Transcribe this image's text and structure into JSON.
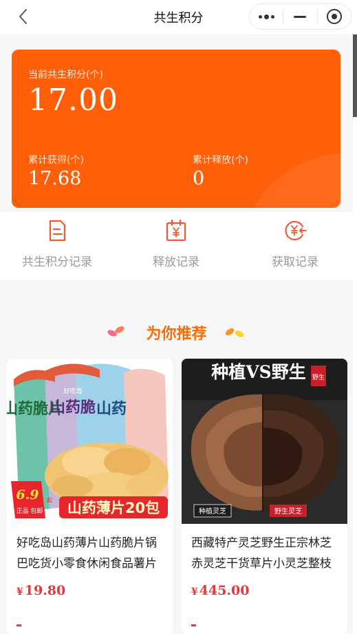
{
  "header": {
    "title": "共生积分",
    "back_icon": "chevron-left-icon",
    "capsule": {
      "more_icon": "more-dots-icon",
      "minimize_icon": "minus-icon",
      "close_icon": "target-icon"
    }
  },
  "points_card": {
    "current_label": "当前共生积分(个)",
    "current_value": "17.00",
    "earned_label": "累计获得(个)",
    "earned_value": "17.68",
    "released_label": "累计释放(个)",
    "released_value": "0",
    "background_color": "#ff5f08"
  },
  "shortcuts": [
    {
      "label": "共生积分记录",
      "icon": "document-icon"
    },
    {
      "label": "释放记录",
      "icon": "calendar-yen-icon"
    },
    {
      "label": "获取记录",
      "icon": "yen-coin-arrow-icon"
    }
  ],
  "recommend": {
    "title": "为你推荐",
    "accent_color": "#ff6a00"
  },
  "products": [
    {
      "name": "好吃岛山药薄片山药脆片锅巴吃货小零食休闲食品薯片",
      "currency": "¥",
      "price": "19.80",
      "image": {
        "bag_text": "山药脆片",
        "bag_text_2": "山药脆",
        "bag_text_3": "山药",
        "brand": "好吃岛",
        "badge_price": "6.9",
        "badge_unit": "起",
        "badge_sub": "正品 包邮",
        "banner": "山药薄片20包"
      }
    },
    {
      "name": "西藏特产灵芝野生正宗林芝赤灵芝干货草片小灵芝整枝",
      "currency": "¥",
      "price": "445.00",
      "image": {
        "headline": "种植VS野生",
        "corner_tag": "野生",
        "left_label": "种植灵芝",
        "right_label": "野生灵芝"
      }
    }
  ],
  "colors": {
    "price": "#e4393c",
    "page_bg": "#f6f6f6"
  }
}
